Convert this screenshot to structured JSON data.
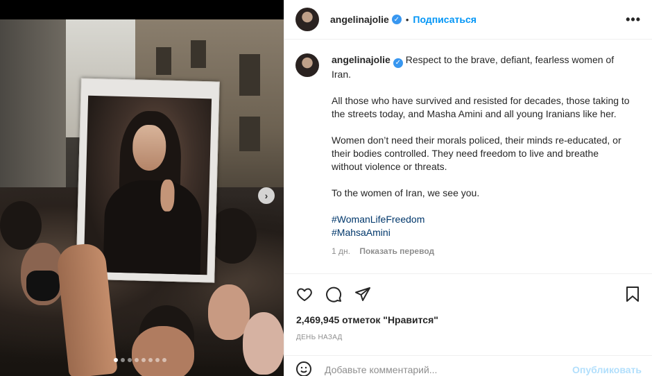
{
  "post": {
    "author": {
      "username": "angelinajolie",
      "verified_icon": "verified-badge-icon",
      "separator": "•",
      "follow_label": "Подписаться",
      "more_label": "•••"
    },
    "caption": {
      "first_line": "Respect to the brave, defiant, fearless women of Iran.",
      "paragraphs": [
        "All those who have survived and resisted for decades, those taking to the streets today, and Masha Amini and all young Iranians like her.",
        "Women don’t need their morals policed, their minds re-educated, or their bodies controlled. They need freedom to live and breathe without violence or threats.",
        "To the women of Iran, we see you."
      ],
      "hashtags": [
        "#WomanLifeFreedom",
        "#MahsaAmini"
      ],
      "age": "1 дн.",
      "translate_label": "Показать перевод"
    },
    "carousel": {
      "total_slides": 8,
      "active_index": 0,
      "next_icon": "chevron-right-icon"
    },
    "actions": {
      "icons": [
        "heart-icon",
        "comment-icon",
        "share-icon",
        "bookmark-icon"
      ]
    },
    "likes_text": "2,469,945 отметок \"Нравится\"",
    "time_ago": "ДЕНЬ НАЗАД",
    "comment": {
      "placeholder": "Добавьте комментарий...",
      "publish_label": "Опубликовать"
    }
  },
  "colors": {
    "link": "#0095f6",
    "hashtag": "#00376b",
    "muted": "#8e8e8e",
    "verified": "#3897f0"
  }
}
